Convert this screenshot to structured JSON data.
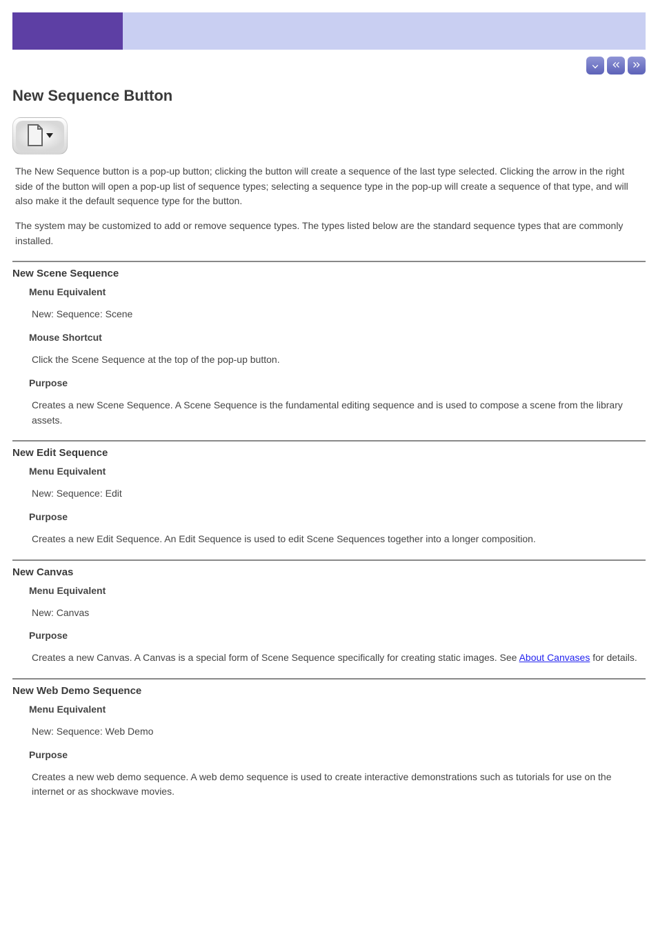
{
  "page": {
    "title": "New Sequence Button",
    "intro": "The New Sequence button is a pop-up button; clicking the button will create a sequence of the last type selected. Clicking the arrow in the right side of the button will open a pop-up list of sequence types; selecting a sequence type in the pop-up will create a sequence of that type, and will also make it the default sequence type for the button.",
    "notice": "The system may be customized to add or remove sequence types. The types listed below are the standard sequence types that are commonly installed."
  },
  "sections": [
    {
      "heading": "New Scene Sequence",
      "items": [
        {
          "title": "Menu Equivalent",
          "body": "New: Sequence: Scene"
        },
        {
          "title": "Mouse Shortcut",
          "body": "Click the Scene Sequence at the top of the pop-up button."
        },
        {
          "title": "Purpose",
          "body": "Creates a new Scene Sequence. A Scene Sequence is the fundamental editing sequence and is used to compose a scene from the library assets."
        }
      ]
    },
    {
      "heading": "New Edit Sequence",
      "items": [
        {
          "title": "Menu Equivalent",
          "body": "New: Sequence: Edit"
        },
        {
          "title": "Purpose",
          "body": "Creates a new Edit Sequence. An Edit Sequence is used to edit Scene Sequences together into a longer composition."
        }
      ]
    },
    {
      "heading": "New Canvas",
      "items": [
        {
          "title": "Menu Equivalent",
          "body": "New: Canvas"
        },
        {
          "title": "Purpose",
          "body_prefix": "Creates a new Canvas. A Canvas is a special form of Scene Sequence specifically for creating static images. See ",
          "link_text": "About Canvases",
          "body_suffix": " for details."
        }
      ]
    },
    {
      "heading": "New Web Demo Sequence",
      "items": [
        {
          "title": "Menu Equivalent",
          "body": "New: Sequence: Web Demo"
        },
        {
          "title": "Purpose",
          "body": "Creates a new web demo sequence. A web demo sequence is used to create interactive demonstrations such as tutorials for use on the internet or as shockwave movies."
        }
      ]
    }
  ]
}
